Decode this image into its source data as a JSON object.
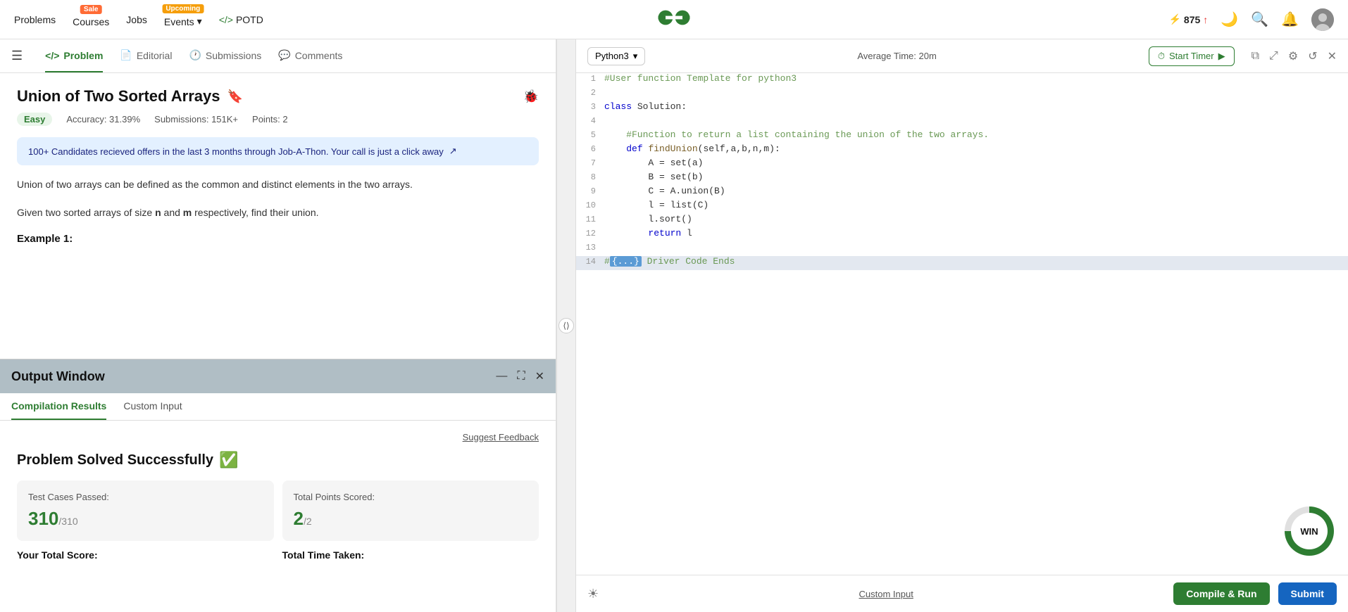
{
  "nav": {
    "problems": "Problems",
    "courses": "Courses",
    "jobs": "Jobs",
    "events": "Events",
    "potd": "POTD",
    "badge_sale": "Sale",
    "badge_upcoming": "Upcoming",
    "streak": "875",
    "logo_alt": "GeeksForGeeks"
  },
  "problem_tabs": {
    "problem": "Problem",
    "editorial": "Editorial",
    "submissions": "Submissions",
    "comments": "Comments"
  },
  "problem": {
    "title": "Union of Two Sorted Arrays",
    "difficulty": "Easy",
    "accuracy": "Accuracy: 31.39%",
    "submissions": "Submissions: 151K+",
    "points": "Points: 2",
    "job_banner": "100+ Candidates recieved offers in the last 3 months through Job-A-Thon. Your call is just a click away",
    "desc1": "Union of two arrays can be defined as the common and distinct elements in the two arrays.",
    "desc2": "Given two sorted arrays of size ",
    "n": "n",
    "and": " and ",
    "m": "m",
    "desc3": " respectively, find their union.",
    "example_heading": "Example 1:"
  },
  "output_window": {
    "title": "Output Window",
    "tab_compilation": "Compilation Results",
    "tab_custom": "Custom Input",
    "suggest_feedback": "Suggest Feedback",
    "success_text": "Problem Solved Successfully",
    "test_cases_label": "Test Cases Passed:",
    "test_cases_value": "310",
    "test_cases_total": "/310",
    "points_label": "Total Points Scored:",
    "points_value": "2",
    "points_total": "/2",
    "score_label": "Your Total Score:",
    "time_label": "Total Time Taken:"
  },
  "editor": {
    "language": "Python3",
    "avg_time": "Average Time: 20m",
    "timer_btn": "Start Timer",
    "code_lines": [
      {
        "num": 1,
        "text": "#User function Template for python3",
        "type": "comment"
      },
      {
        "num": 2,
        "text": "",
        "type": "normal"
      },
      {
        "num": 3,
        "text": "class Solution:",
        "type": "keyword"
      },
      {
        "num": 4,
        "text": "",
        "type": "normal"
      },
      {
        "num": 5,
        "text": "    #Function to return a list containing the union of the two arrays.",
        "type": "comment"
      },
      {
        "num": 6,
        "text": "    def findUnion(self,a,b,n,m):",
        "type": "def"
      },
      {
        "num": 7,
        "text": "        A = set(a)",
        "type": "normal"
      },
      {
        "num": 8,
        "text": "        B = set(b)",
        "type": "normal"
      },
      {
        "num": 9,
        "text": "        C = A.union(B)",
        "type": "normal"
      },
      {
        "num": 10,
        "text": "        l = list(C)",
        "type": "normal"
      },
      {
        "num": 11,
        "text": "        l.sort()",
        "type": "normal"
      },
      {
        "num": 12,
        "text": "        return l",
        "type": "normal"
      },
      {
        "num": 13,
        "text": "",
        "type": "normal"
      },
      {
        "num": 14,
        "text": "#{ ... } Driver Code Ends",
        "type": "highlight"
      }
    ]
  },
  "bottom_bar": {
    "custom_input": "Custom Input",
    "compile_run": "Compile & Run",
    "submit": "Submit"
  },
  "win_widget": "WIN"
}
